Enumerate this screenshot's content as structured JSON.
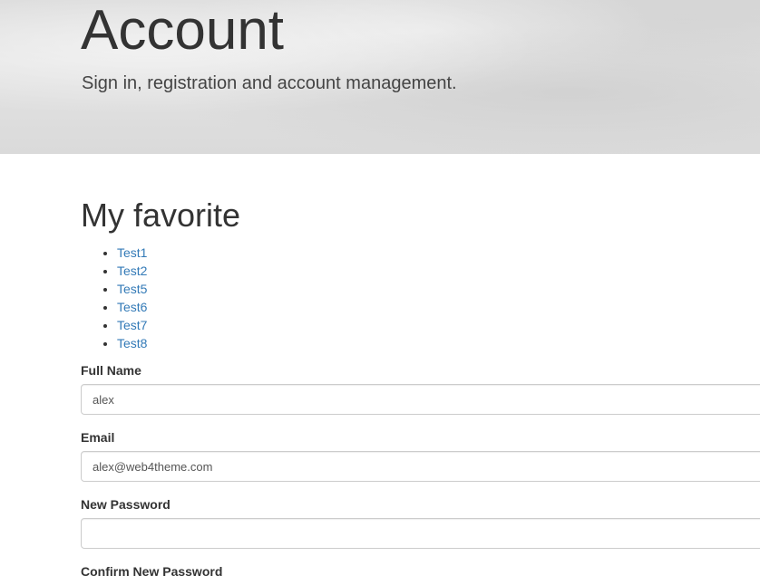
{
  "header": {
    "title": "Account",
    "subtitle": "Sign in, registration and account management."
  },
  "favorites": {
    "title": "My favorite",
    "items": [
      {
        "label": "Test1"
      },
      {
        "label": "Test2"
      },
      {
        "label": "Test5"
      },
      {
        "label": "Test6"
      },
      {
        "label": "Test7"
      },
      {
        "label": "Test8"
      }
    ]
  },
  "form": {
    "full_name": {
      "label": "Full Name",
      "value": "alex"
    },
    "email": {
      "label": "Email",
      "value": "alex@web4theme.com"
    },
    "new_password": {
      "label": "New Password",
      "value": ""
    },
    "confirm_password": {
      "label": "Confirm New Password",
      "value": ""
    }
  },
  "colors": {
    "link": "#337ab7",
    "text": "#333333"
  }
}
